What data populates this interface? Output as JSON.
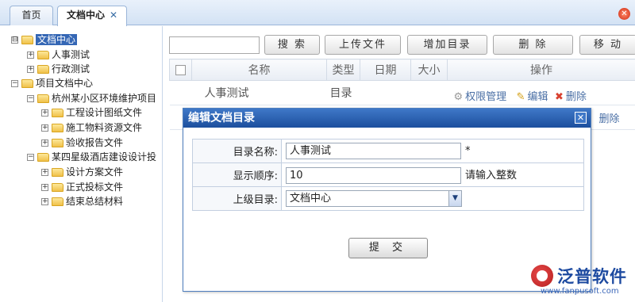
{
  "tabs": [
    {
      "label": "首页"
    },
    {
      "label": "文档中心",
      "close": "✕"
    }
  ],
  "close_all_icon": "✕",
  "tree": [
    {
      "label": "文档中心",
      "toggle": "⊟",
      "selected": true
    },
    {
      "label": "人事测试",
      "toggle": "+"
    },
    {
      "label": "行政测试",
      "toggle": "+"
    },
    {
      "label": "项目文档中心",
      "toggle": "−"
    },
    {
      "label": "杭州某小区环境维护项目",
      "toggle": "−"
    },
    {
      "label": "工程设计图纸文件",
      "toggle": "+"
    },
    {
      "label": "施工物料资源文件",
      "toggle": "+"
    },
    {
      "label": "验收报告文件",
      "toggle": "+"
    },
    {
      "label": "某四星级酒店建设设计投",
      "toggle": "−"
    },
    {
      "label": "设计方案文件",
      "toggle": "+"
    },
    {
      "label": "正式投标文件",
      "toggle": "+"
    },
    {
      "label": "结束总结材料",
      "toggle": "+"
    }
  ],
  "toolbar": {
    "search": "搜 索",
    "upload": "上传文件",
    "add_dir": "增加目录",
    "delete": "删 除",
    "move": "移 动"
  },
  "grid": {
    "headers": [
      "名称",
      "类型",
      "日期",
      "大小",
      "操作"
    ],
    "rows": [
      {
        "name": "人事测试",
        "type": "目录",
        "date": "",
        "size": ""
      }
    ],
    "actions": {
      "perm": "权限管理",
      "edit": "编辑",
      "delete": "删除"
    }
  },
  "dialog": {
    "title": "编辑文档目录",
    "close": "✕",
    "fields": {
      "name_label": "目录名称:",
      "name_value": "人事测试",
      "name_required": "*",
      "order_label": "显示顺序:",
      "order_value": "10",
      "order_hint": "请输入整数",
      "parent_label": "上级目录:",
      "parent_value": "文档中心"
    },
    "submit": "提 交"
  },
  "logo": {
    "brand": "泛普软件",
    "url": "www.fanpusoft.com"
  },
  "colors": {
    "accent": "#1c4f9d",
    "selected": "#3567b5",
    "link": "#4a6fa5"
  }
}
